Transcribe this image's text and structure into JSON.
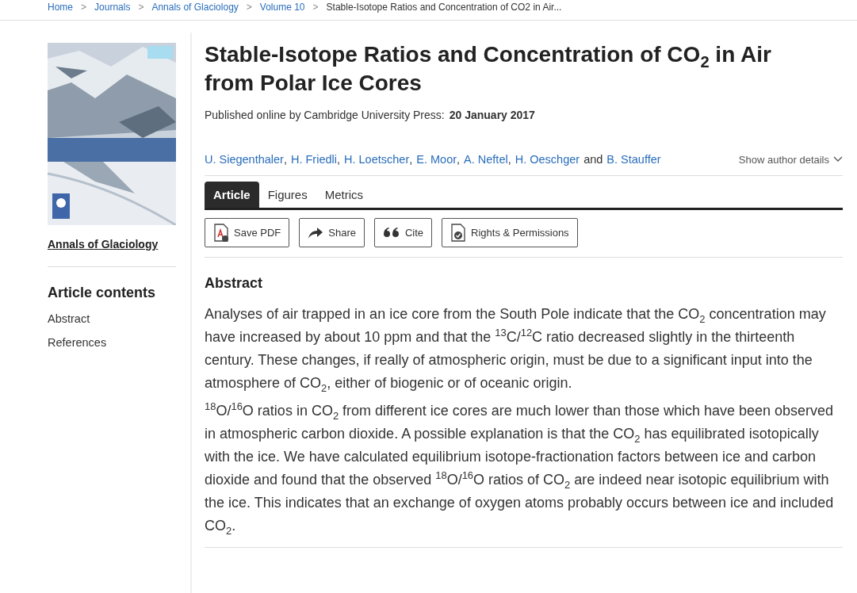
{
  "breadcrumbs": [
    {
      "label": "Home",
      "kind": "link",
      "separator": ">"
    },
    {
      "label": "Journals",
      "kind": "link",
      "separator": ">"
    },
    {
      "label": "Annals of Glaciology",
      "kind": "link",
      "separator": ">"
    },
    {
      "label": "Volume 10",
      "kind": "link",
      "separator": ">"
    },
    {
      "label": "Stable-Isotope Ratios and Concentration of CO2 in Air...",
      "kind": "current"
    }
  ],
  "sidebar": {
    "cover": {
      "kind": "picture"
    },
    "journal_link": "Annals of Glaciology",
    "contents_title": "Article contents",
    "contents": [
      "Abstract",
      "References"
    ]
  },
  "article": {
    "title": "Stable-Isotope Ratios and Concentration of CO$_{2}$ in Air from Polar Ice Cores",
    "published_label": "Published online by Cambridge University Press:",
    "published_date": "20 January 2017",
    "authors": [
      {
        "name": "U. Siegenthaler",
        "separator": ","
      },
      {
        "name": "H. Friedli",
        "separator": ","
      },
      {
        "name": "H. Loetscher",
        "separator": ","
      },
      {
        "name": "E. Moor",
        "separator": ","
      },
      {
        "name": "A. Neftel",
        "separator": ","
      },
      {
        "name": "H. Oeschger",
        "separator": "and"
      },
      {
        "name": "B. Stauffer"
      }
    ],
    "author_details": "Show author details",
    "tabs": [
      {
        "label": "Article",
        "selected": true
      },
      {
        "label": "Figures",
        "selected": false
      },
      {
        "label": "Metrics",
        "selected": false
      }
    ],
    "actions": [
      {
        "label": "Save PDF",
        "kind": "pdf"
      },
      {
        "label": "Share",
        "kind": "share"
      },
      {
        "label": "Cite",
        "kind": "cite"
      },
      {
        "label": "Rights & Permissions",
        "kind": "rights"
      }
    ],
    "abstract_title": "Abstract",
    "abstract": [
      "Analyses of air trapped in an ice core from the South Pole indicate that the CO$_{2}$ concentration may have increased by about 10 ppm and that the $^{13}$C/$^{12}$C ratio decreased slightly in the thirteenth century. These changes, if really of atmospheric origin, must be due to a significant input into the atmosphere of CO$_{2}$, either of biogenic or of oceanic origin.",
      "$^{18}$O/$^{16}$O ratios in CO$_{2}$ from different ice cores are much lower than those which have been observed in atmospheric carbon dioxide. A possible explanation is that the CO$_{2}$ has equilibrated isotopically with the ice. We have calculated equilibrium isotope-fractionation factors between ice and carbon dioxide and found that the observed $^{18}$O/$^{16}$O ratios of CO$_{2}$ are indeed near isotopic equilibrium with the ice. This indicates that an exchange of oxygen atoms probably occurs between ice and included CO$_{2}$."
    ]
  }
}
